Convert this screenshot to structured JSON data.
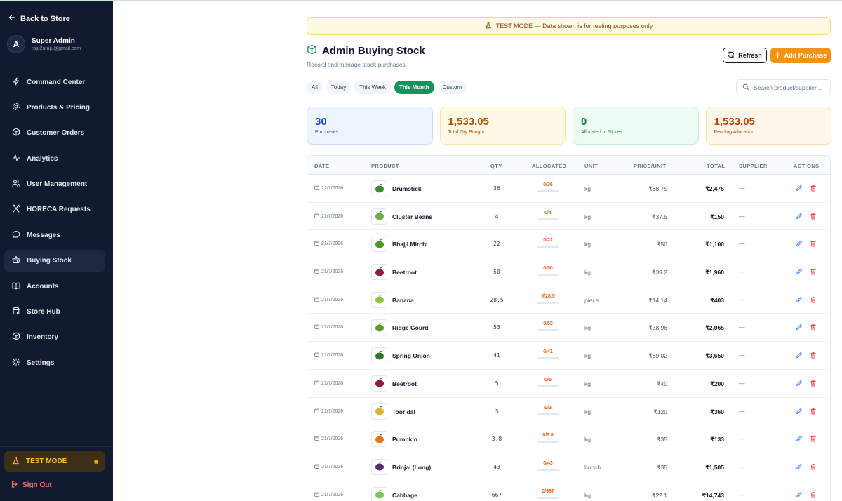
{
  "sidebar": {
    "back": "Back to Store",
    "user": {
      "initial": "A",
      "name": "Super Admin",
      "email": "raju2uraju@gmail.com"
    },
    "nav": [
      {
        "label": "Command Center",
        "icon": "bolt-icon"
      },
      {
        "label": "Products & Pricing",
        "icon": "gear-icon"
      },
      {
        "label": "Customer Orders",
        "icon": "box-icon"
      },
      {
        "label": "Analytics",
        "icon": "pulse-icon"
      },
      {
        "label": "User Management",
        "icon": "users-icon"
      },
      {
        "label": "HORECA Requests",
        "icon": "utensils-icon"
      },
      {
        "label": "Messages",
        "icon": "chat-icon"
      },
      {
        "label": "Buying Stock",
        "icon": "basket-icon",
        "active": true
      },
      {
        "label": "Accounts",
        "icon": "book-icon"
      },
      {
        "label": "Store Hub",
        "icon": "store-icon"
      },
      {
        "label": "Inventory",
        "icon": "cube-icon"
      },
      {
        "label": "Settings",
        "icon": "cog-icon"
      }
    ],
    "test_mode": "TEST MODE",
    "sign_out": "Sign Out"
  },
  "banner": "TEST MODE — Data shown is for testing purposes only",
  "header": {
    "title": "Admin Buying Stock",
    "subtitle": "Record and manage stock purchases",
    "refresh": "Refresh",
    "add": "Add Purchase"
  },
  "filters": [
    "All",
    "Today",
    "This Week",
    "This Month",
    "Custom"
  ],
  "active_filter": "This Month",
  "search": {
    "placeholder": "Search product/supplier..."
  },
  "stats": [
    {
      "value": "30",
      "label": "Purchases"
    },
    {
      "value": "1,533.05",
      "label": "Total Qty Bought"
    },
    {
      "value": "0",
      "label": "Allocated to Stores"
    },
    {
      "value": "1,533.05",
      "label": "Pending Allocation"
    }
  ],
  "table": {
    "columns": [
      "DATE",
      "PRODUCT",
      "QTY",
      "ALLOCATED",
      "UNIT",
      "PRICE/UNIT",
      "TOTAL",
      "SUPPLIER",
      "ACTIONS"
    ],
    "rows": [
      {
        "date": "21/7/2026",
        "product": "Drumstick",
        "qty": "36",
        "allocated": "0/36",
        "unit": "kg",
        "price": "₹68.75",
        "total": "₹2,475",
        "supplier": "—",
        "thumb": "#3f8a2e"
      },
      {
        "date": "21/7/2026",
        "product": "Cluster Beans",
        "qty": "4",
        "allocated": "0/4",
        "unit": "kg",
        "price": "₹37.5",
        "total": "₹150",
        "supplier": "—",
        "thumb": "#6ab04c"
      },
      {
        "date": "21/7/2026",
        "product": "Bhajji Mirchi",
        "qty": "22",
        "allocated": "0/22",
        "unit": "kg",
        "price": "₹50",
        "total": "₹1,100",
        "supplier": "—",
        "thumb": "#4c9a2a"
      },
      {
        "date": "21/7/2026",
        "product": "Beetroot",
        "qty": "50",
        "allocated": "0/50",
        "unit": "kg",
        "price": "₹39.2",
        "total": "₹1,960",
        "supplier": "—",
        "thumb": "#8b1e3f"
      },
      {
        "date": "21/7/2026",
        "product": "Banana",
        "qty": "28.5",
        "allocated": "0/28.5",
        "unit": "piece",
        "price": "₹14.14",
        "total": "₹403",
        "supplier": "—",
        "thumb": "#8cc63f"
      },
      {
        "date": "21/7/2026",
        "product": "Ridge Gourd",
        "qty": "53",
        "allocated": "0/53",
        "unit": "kg",
        "price": "₹38.96",
        "total": "₹2,065",
        "supplier": "—",
        "thumb": "#5a9e32"
      },
      {
        "date": "21/7/2026",
        "product": "Spring Onion",
        "qty": "41",
        "allocated": "0/41",
        "unit": "kg",
        "price": "₹89.02",
        "total": "₹3,650",
        "supplier": "—",
        "thumb": "#2f7a2a"
      },
      {
        "date": "21/7/2026",
        "product": "Beetroot",
        "qty": "5",
        "allocated": "0/5",
        "unit": "kg",
        "price": "₹40",
        "total": "₹200",
        "supplier": "—",
        "thumb": "#8b1e3f"
      },
      {
        "date": "21/7/2026",
        "product": "Toor dal",
        "qty": "3",
        "allocated": "0/3",
        "unit": "kg",
        "price": "₹120",
        "total": "₹360",
        "supplier": "—",
        "thumb": "#e0b13a"
      },
      {
        "date": "21/7/2026",
        "product": "Pumpkin",
        "qty": "3.8",
        "allocated": "0/3.8",
        "unit": "kg",
        "price": "₹35",
        "total": "₹133",
        "supplier": "—",
        "thumb": "#e8741a"
      },
      {
        "date": "21/7/2026",
        "product": "Brinjal (Long)",
        "qty": "43",
        "allocated": "0/43",
        "unit": "bunch",
        "price": "₹35",
        "total": "₹1,505",
        "supplier": "—",
        "thumb": "#5b2a6e"
      },
      {
        "date": "21/7/2026",
        "product": "Cabbage",
        "qty": "667",
        "allocated": "0/667",
        "unit": "kg",
        "price": "₹22.1",
        "total": "₹14,743",
        "supplier": "—",
        "thumb": "#7cc45a"
      }
    ]
  }
}
